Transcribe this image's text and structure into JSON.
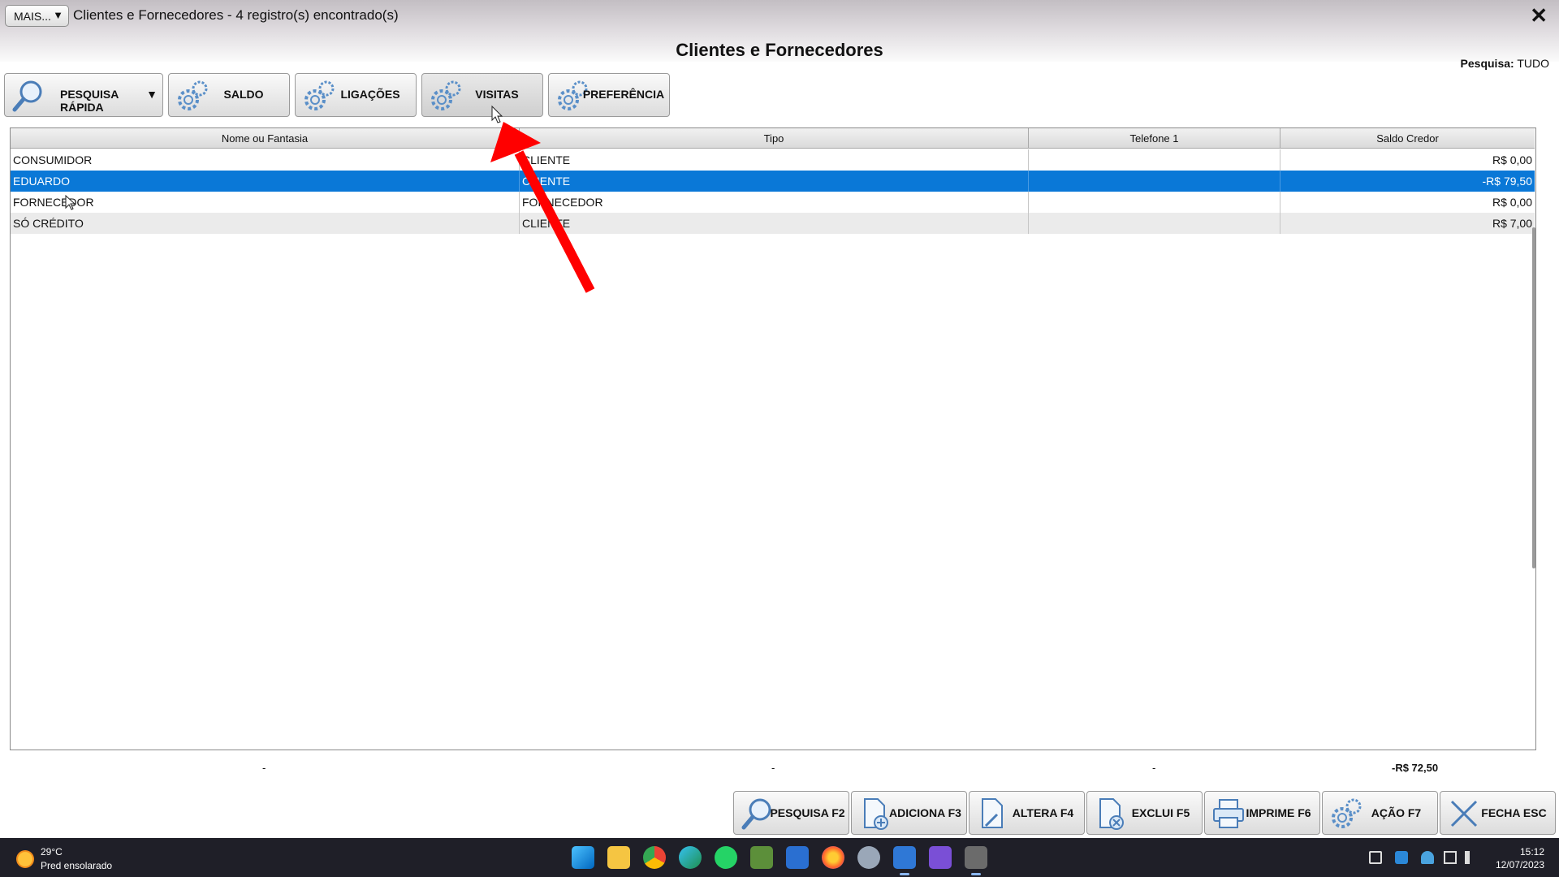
{
  "window": {
    "mais_label": "MAIS...",
    "title": "Clientes e Fornecedores - 4 registro(s) encontrado(s)",
    "heading": "Clientes e Fornecedores",
    "close": "✕",
    "search_scope_label": "Pesquisa:",
    "search_scope_value": "TUDO"
  },
  "toolbar": {
    "quick_search": "PESQUISA RÁPIDA",
    "dropdown_arrow": "▼",
    "saldo": "SALDO",
    "ligacoes": "LIGAÇÕES",
    "visitas": "VISITAS",
    "preferencia": "PREFERÊNCIA"
  },
  "grid": {
    "columns": [
      "Nome ou Fantasia",
      "Tipo",
      "Telefone 1",
      "Saldo Credor"
    ],
    "rows": [
      {
        "nome": "CONSUMIDOR",
        "tipo": "CLIENTE",
        "telefone": "",
        "saldo": "R$ 0,00"
      },
      {
        "nome": "EDUARDO",
        "tipo": "CLIENTE",
        "telefone": "",
        "saldo": "-R$ 79,50"
      },
      {
        "nome": "FORNECEDOR",
        "tipo": "FORNECEDOR",
        "telefone": "",
        "saldo": "R$ 0,00"
      },
      {
        "nome": "SÓ CRÉDITO",
        "tipo": "CLIENTE",
        "telefone": "",
        "saldo": "R$ 7,00"
      }
    ],
    "selected_row": 1
  },
  "totals": {
    "nome": "-",
    "tipo": "-",
    "telefone": "-",
    "saldo": "-R$ 72,50"
  },
  "actions": {
    "pesquisa": "PESQUISA F2",
    "adiciona": "ADICIONA F3",
    "altera": "ALTERA F4",
    "exclui": "EXCLUI F5",
    "imprime": "IMPRIME F6",
    "acao": "AÇÃO F7",
    "fecha": "FECHA ESC"
  },
  "taskbar": {
    "temperature": "29°C",
    "condition": "Pred ensolarado",
    "time": "15:12",
    "date": "12/07/2023"
  },
  "colors": {
    "selection": "#0a78d7",
    "annotation_arrow": "#ff0000",
    "taskbar": "#1f1f28"
  }
}
